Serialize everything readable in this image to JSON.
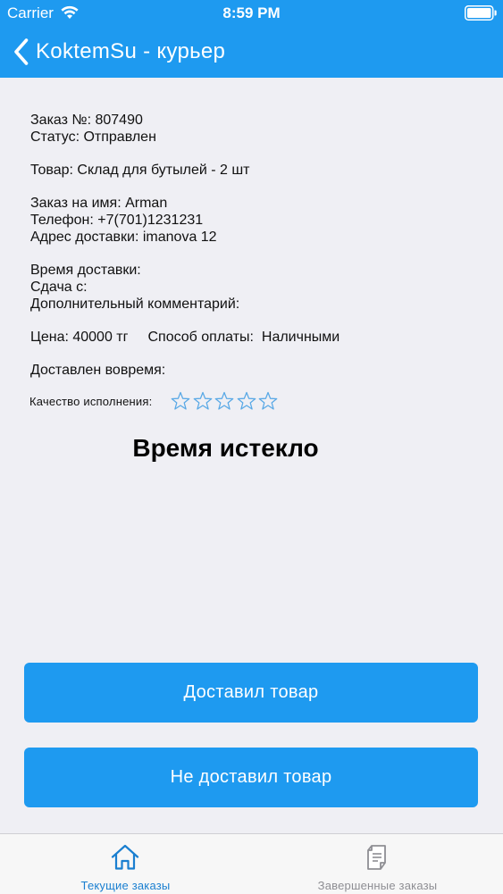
{
  "status_bar": {
    "carrier": "Carrier",
    "time": "8:59 PM",
    "wifi_icon": "wifi-icon",
    "battery_icon": "battery-icon"
  },
  "nav": {
    "back_icon": "chevron-left-icon",
    "title": "KoktemSu - курьер"
  },
  "order": {
    "number": "Заказ №: 807490",
    "status": "Статус: Отправлен",
    "product": "Товар: Склад для бутылей - 2 шт",
    "customer_name": "Заказ на имя: Arman",
    "phone": "Телефон: +7(701)1231231",
    "address": "Адрес доставки: imanova 12",
    "delivery_time": "Время доставки:",
    "change_from": "Сдача с:",
    "comment": "Дополнительный комментарий:",
    "price": "Цена: 40000 тг",
    "payment": "Способ оплаты:  Наличными",
    "on_time": "Доставлен вовремя:"
  },
  "quality": {
    "label": "Качество исполнения:",
    "rating": 0,
    "max": 5,
    "star_color": "#5aa9e6"
  },
  "timer": {
    "message": "Время истекло"
  },
  "buttons": {
    "delivered": "Доставил товар",
    "not_delivered": "Не доставил товар"
  },
  "tabs": {
    "current": {
      "label": "Текущие заказы",
      "icon": "home-icon",
      "active": true
    },
    "completed": {
      "label": "Завершенные заказы",
      "icon": "document-icon",
      "active": false
    }
  },
  "colors": {
    "accent": "#1e9af0",
    "background": "#efeff4",
    "tab_active": "#1a7fd0",
    "tab_inactive": "#8e8e93"
  }
}
